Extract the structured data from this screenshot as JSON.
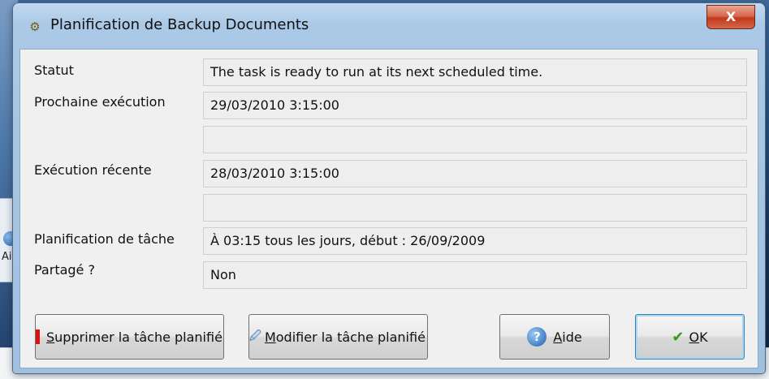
{
  "window": {
    "title": "Planification de  Backup Documents",
    "close_glyph": "X",
    "title_icon": "task-scheduler-icon"
  },
  "background": {
    "partial_label": "Aic"
  },
  "fields": [
    {
      "label": "Statut",
      "value": "The task is ready to run at its next scheduled time."
    },
    {
      "label": "Prochaine exécution",
      "value": "29/03/2010 3:15:00"
    },
    {
      "label": "",
      "value": ""
    },
    {
      "label": "Exécution récente",
      "value": "28/03/2010 3:15:00"
    },
    {
      "label": "",
      "value": ""
    },
    {
      "label": "Planification de tâche",
      "value": "À 03:15 tous les jours, début : 26/09/2009"
    },
    {
      "label": "Partagé ?",
      "value": "Non"
    }
  ],
  "buttons": {
    "delete": {
      "mnemonic": "S",
      "rest": "upprimer la tâche planifié",
      "icon": "delete-icon"
    },
    "modify": {
      "mnemonic": "M",
      "rest": "odifier la tâche planifié",
      "icon": "edit-icon"
    },
    "help": {
      "mnemonic": "A",
      "rest": "ide",
      "icon": "help-icon"
    },
    "ok": {
      "mnemonic": "O",
      "rest": "K",
      "icon": "checkmark-icon"
    }
  }
}
